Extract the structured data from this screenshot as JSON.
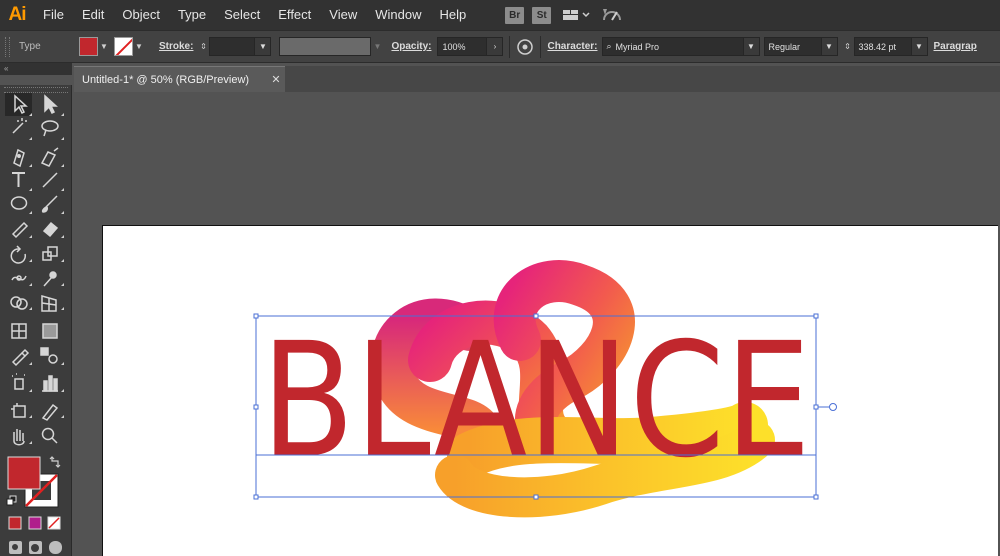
{
  "app": {
    "logo": "Ai"
  },
  "menubar": {
    "items": [
      "File",
      "Edit",
      "Object",
      "Type",
      "Select",
      "Effect",
      "View",
      "Window",
      "Help"
    ],
    "bridge": "Br",
    "stock": "St"
  },
  "controlbar": {
    "type_label": "Type",
    "fill_color": "#c1272d",
    "stroke_label": "Stroke:",
    "stroke_weight": "",
    "opacity_label": "Opacity:",
    "opacity_value": "100%",
    "character_label": "Character:",
    "font_family": "Myriad Pro",
    "font_style": "Regular",
    "font_size": "338.42 pt",
    "paragraph_label": "Paragrap"
  },
  "document": {
    "tab_title": "Untitled-1* @ 50% (RGB/Preview)",
    "close_glyph": "✕"
  },
  "artwork": {
    "text": "BLANCE",
    "text_color": "#c1272d",
    "selection_color": "#4a6fd6",
    "gradient_colors": [
      "#e6247a",
      "#f25a4e",
      "#f7a02a",
      "#fde02a"
    ]
  },
  "tools": {
    "fill_swatch": "#c1272d",
    "stroke_swatch": "none",
    "mode_colors": [
      "#c1272d",
      "#b01e8c",
      "none"
    ]
  }
}
